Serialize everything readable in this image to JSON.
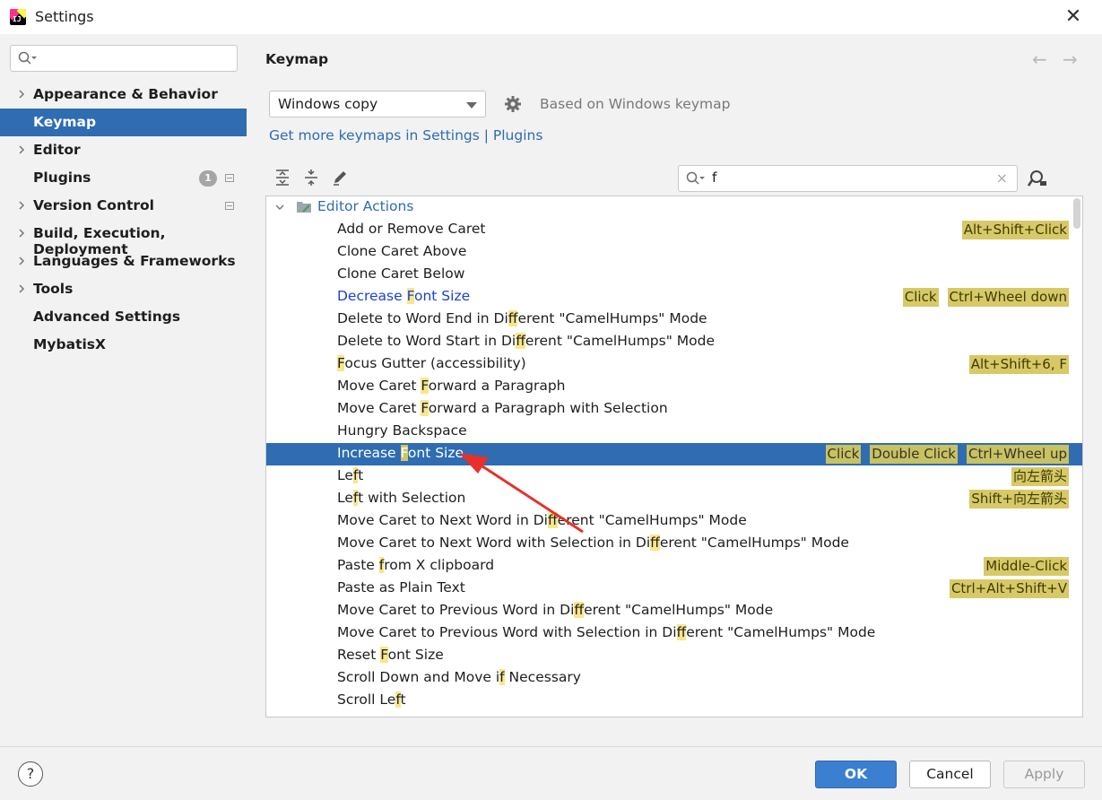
{
  "window": {
    "title": "Settings",
    "close": "✕"
  },
  "sidebar": {
    "search_placeholder": "",
    "items": [
      {
        "label": "Appearance & Behavior",
        "expandable": true
      },
      {
        "label": "Keymap",
        "expandable": false,
        "selected": true
      },
      {
        "label": "Editor",
        "expandable": true
      },
      {
        "label": "Plugins",
        "expandable": false,
        "badge": "1"
      },
      {
        "label": "Version Control",
        "expandable": true
      },
      {
        "label": "Build, Execution, Deployment",
        "expandable": true
      },
      {
        "label": "Languages & Frameworks",
        "expandable": true
      },
      {
        "label": "Tools",
        "expandable": true
      },
      {
        "label": "Advanced Settings",
        "expandable": false
      },
      {
        "label": "MybatisX",
        "expandable": false
      }
    ]
  },
  "main": {
    "title": "Keymap",
    "back_arrow": "←",
    "forward_arrow": "→",
    "keymap_value": "Windows copy",
    "based_on": "Based on Windows keymap",
    "more_link": "Get more keymaps in Settings | Plugins",
    "filter_value": "f",
    "filter_clear": "×"
  },
  "tree": {
    "group": "Editor Actions",
    "actions": [
      {
        "parts": [
          "Add or Remove Caret"
        ],
        "shortcuts": [
          "Alt+Shift+Click"
        ]
      },
      {
        "parts": [
          "Clone Caret Above"
        ],
        "shortcuts": []
      },
      {
        "parts": [
          "Clone Caret Below"
        ],
        "shortcuts": []
      },
      {
        "parts": [
          "Decrease ",
          "F",
          "ont Size"
        ],
        "shortcuts": [
          "Click",
          "Ctrl+Wheel down"
        ],
        "style": "blue"
      },
      {
        "parts": [
          "Delete to Word End in Di",
          "ff",
          "erent \"CamelHumps\" Mode"
        ],
        "shortcuts": []
      },
      {
        "parts": [
          "Delete to Word Start in Di",
          "ff",
          "erent \"CamelHumps\" Mode"
        ],
        "shortcuts": []
      },
      {
        "parts": [
          "",
          "F",
          "ocus Gutter (accessibility)"
        ],
        "shortcuts": [
          "Alt+Shift+6, F"
        ]
      },
      {
        "parts": [
          "Move Caret ",
          "F",
          "orward a Paragraph"
        ],
        "shortcuts": []
      },
      {
        "parts": [
          "Move Caret ",
          "F",
          "orward a Paragraph with Selection"
        ],
        "shortcuts": []
      },
      {
        "parts": [
          "Hungry Backspace"
        ],
        "shortcuts": []
      },
      {
        "parts": [
          "Increase ",
          "F",
          "ont Size"
        ],
        "shortcuts": [
          "Click",
          "Double Click",
          "Ctrl+Wheel up"
        ],
        "style": "selected"
      },
      {
        "parts": [
          "Le",
          "f",
          "t"
        ],
        "shortcuts": [
          "向左箭头"
        ]
      },
      {
        "parts": [
          "Le",
          "f",
          "t with Selection"
        ],
        "shortcuts": [
          "Shift+向左箭头"
        ]
      },
      {
        "parts": [
          "Move Caret to Next Word in Di",
          "ff",
          "erent \"CamelHumps\" Mode"
        ],
        "shortcuts": []
      },
      {
        "parts": [
          "Move Caret to Next Word with Selection in Di",
          "ff",
          "erent \"CamelHumps\" Mode"
        ],
        "shortcuts": []
      },
      {
        "parts": [
          "Paste ",
          "f",
          "rom X clipboard"
        ],
        "shortcuts": [
          "Middle-Click"
        ]
      },
      {
        "parts": [
          "Paste as Plain Text"
        ],
        "shortcuts": [
          "Ctrl+Alt+Shift+V"
        ]
      },
      {
        "parts": [
          "Move Caret to Previous Word in Di",
          "ff",
          "erent \"CamelHumps\" Mode"
        ],
        "shortcuts": []
      },
      {
        "parts": [
          "Move Caret to Previous Word with Selection in Di",
          "ff",
          "erent \"CamelHumps\" Mode"
        ],
        "shortcuts": []
      },
      {
        "parts": [
          "Reset ",
          "F",
          "ont Size"
        ],
        "shortcuts": []
      },
      {
        "parts": [
          "Scroll Down and Move i",
          "f",
          " Necessary"
        ],
        "shortcuts": []
      },
      {
        "parts": [
          "Scroll Le",
          "f",
          "t"
        ],
        "shortcuts": []
      }
    ]
  },
  "footer": {
    "help": "?",
    "ok": "OK",
    "cancel": "Cancel",
    "apply": "Apply"
  },
  "colors": {
    "selection": "#2f6cb2",
    "shortcut_bg": "#d8c968",
    "match_highlight": "#f8e68b",
    "ok_button": "#3b7fd0",
    "annotation_arrow": "#e8302a"
  }
}
